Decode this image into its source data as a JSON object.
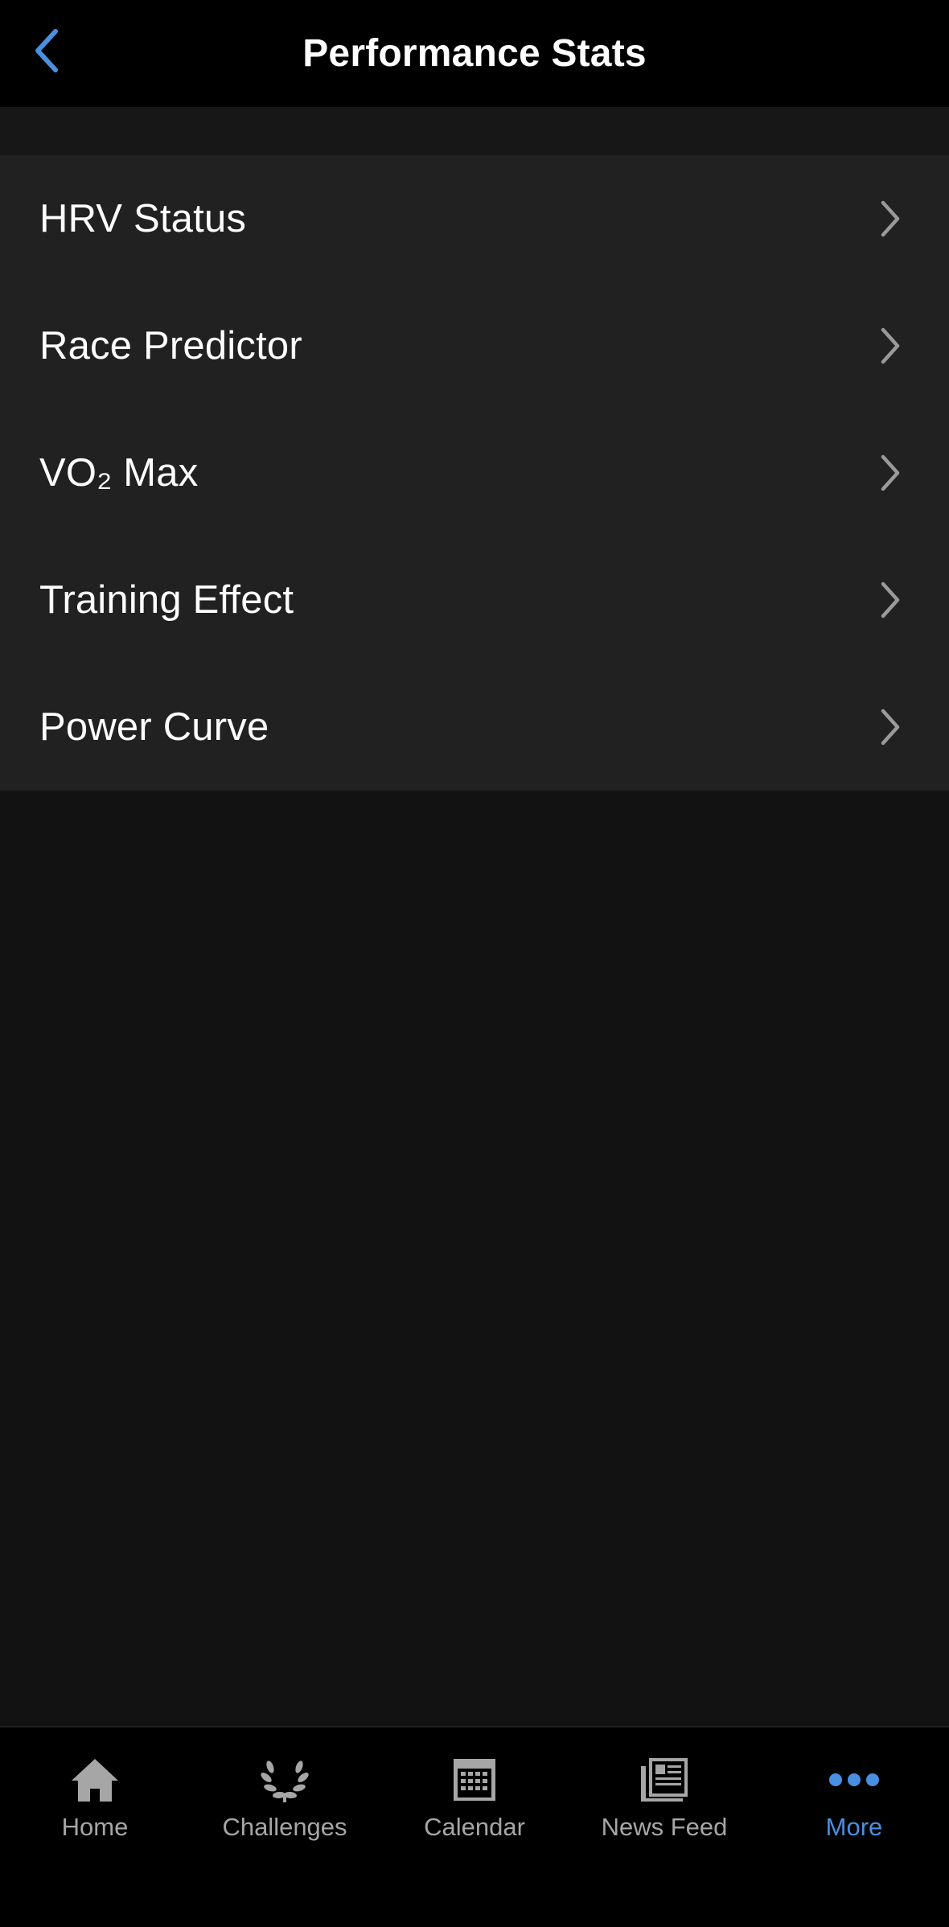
{
  "header": {
    "title": "Performance Stats",
    "back_icon": "chevron-left-icon"
  },
  "menu": {
    "items": [
      {
        "label": "HRV Status",
        "icon": "chevron-right-icon"
      },
      {
        "label": "Race Predictor",
        "icon": "chevron-right-icon"
      },
      {
        "label": "VO₂ Max",
        "icon": "chevron-right-icon"
      },
      {
        "label": "Training Effect",
        "icon": "chevron-right-icon"
      },
      {
        "label": "Power Curve",
        "icon": "chevron-right-icon"
      }
    ]
  },
  "tabbar": {
    "tabs": [
      {
        "label": "Home",
        "icon": "home-icon",
        "active": false
      },
      {
        "label": "Challenges",
        "icon": "laurel-icon",
        "active": false
      },
      {
        "label": "Calendar",
        "icon": "calendar-icon",
        "active": false
      },
      {
        "label": "News Feed",
        "icon": "newspaper-icon",
        "active": false
      },
      {
        "label": "More",
        "icon": "more-dots-icon",
        "active": true
      }
    ]
  },
  "colors": {
    "accent": "#4a90e2",
    "background": "#121212",
    "list_background": "#212121",
    "header_background": "#000000",
    "text_primary": "#ffffff",
    "text_secondary": "#a6a6a6"
  }
}
